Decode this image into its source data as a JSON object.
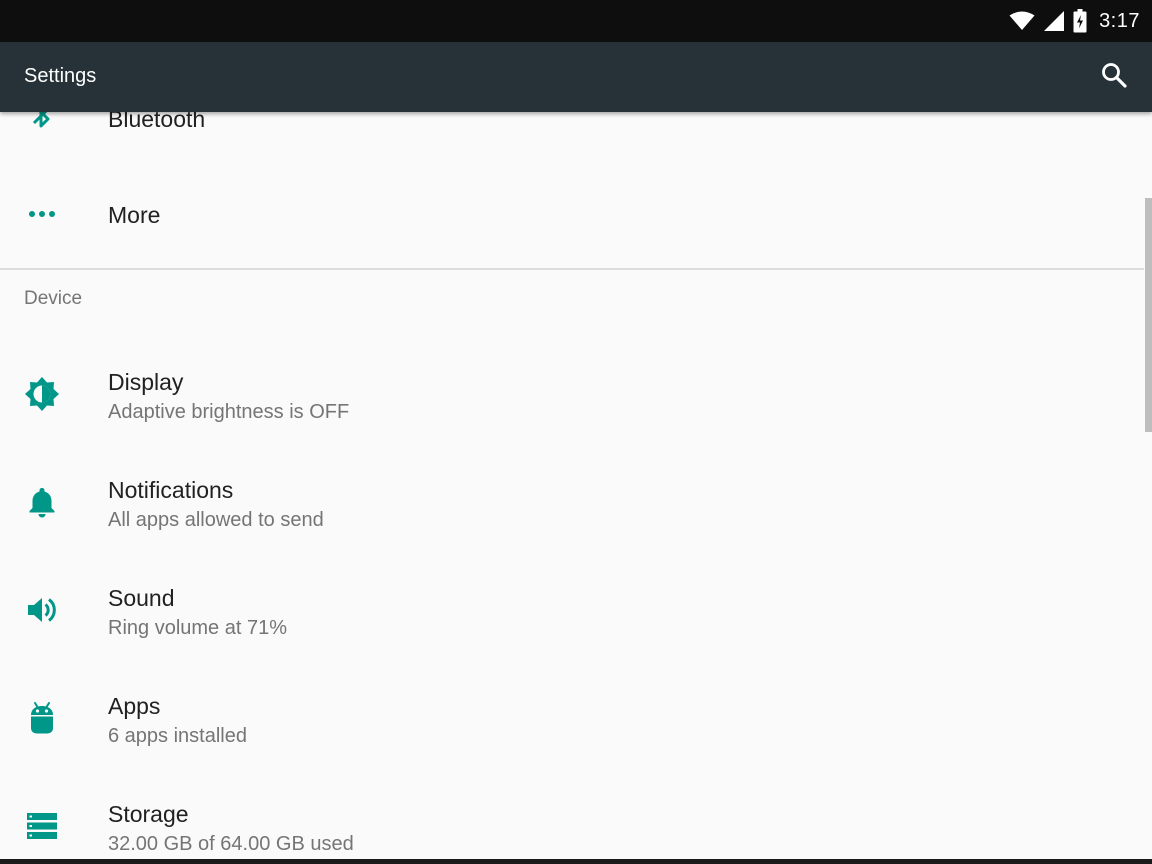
{
  "status_bar": {
    "time": "3:17",
    "icons": [
      "wifi-icon",
      "cell-signal-icon",
      "battery-charging-icon"
    ]
  },
  "app_bar": {
    "title": "Settings",
    "search_icon": "search-icon"
  },
  "partial_item": {
    "title": "Bluetooth",
    "icon": "bluetooth-icon"
  },
  "more_item": {
    "title": "More",
    "icon": "more-horiz-icon"
  },
  "section": {
    "header": "Device"
  },
  "device_items": [
    {
      "title": "Display",
      "subtitle": "Adaptive brightness is OFF",
      "icon": "brightness-icon"
    },
    {
      "title": "Notifications",
      "subtitle": "All apps allowed to send",
      "icon": "bell-icon"
    },
    {
      "title": "Sound",
      "subtitle": "Ring volume at 71%",
      "icon": "volume-icon"
    },
    {
      "title": "Apps",
      "subtitle": "6 apps installed",
      "icon": "android-icon"
    },
    {
      "title": "Storage",
      "subtitle": "32.00 GB of 64.00 GB used",
      "icon": "storage-icon"
    }
  ],
  "colors": {
    "accent": "#009688",
    "app_bar": "#263238",
    "status_bar": "#0e0e0e",
    "background": "#fafafa",
    "primary_text": "#212121",
    "secondary_text": "#757575"
  }
}
